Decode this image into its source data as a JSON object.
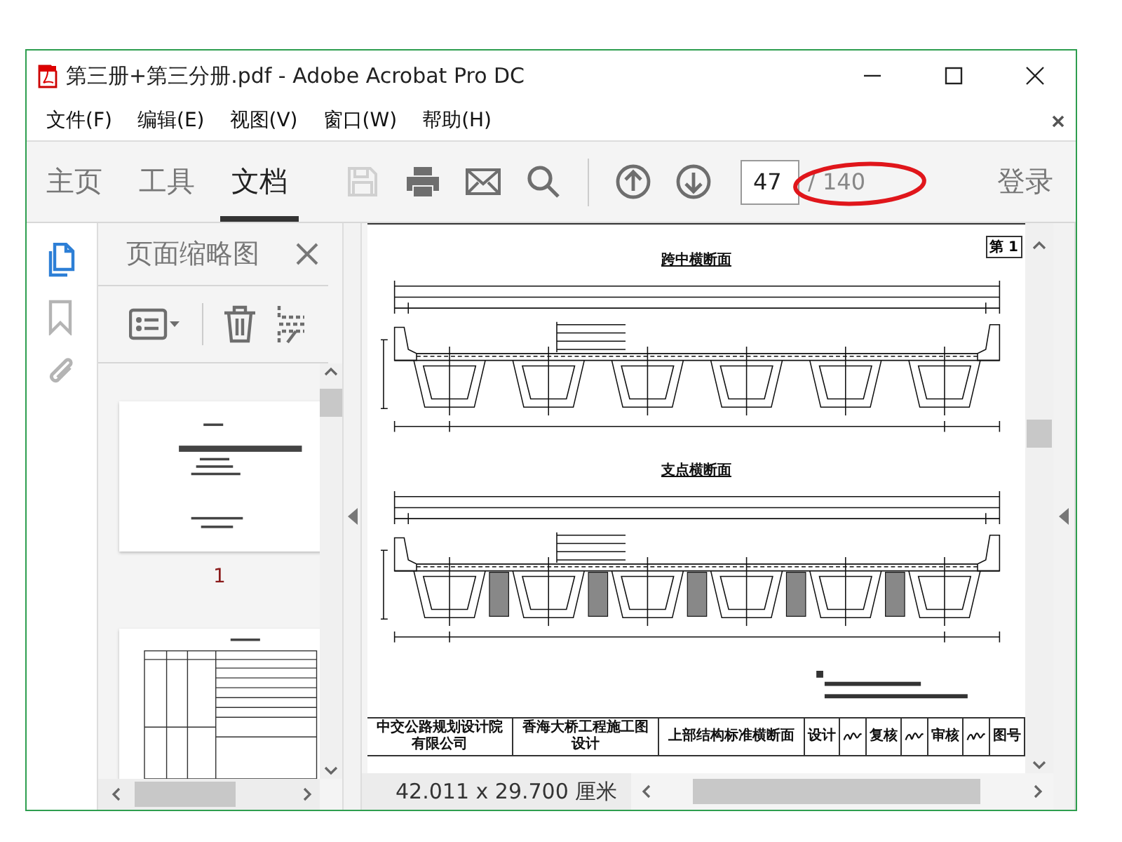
{
  "window": {
    "title": "第三册+第三分册.pdf - Adobe Acrobat Pro DC"
  },
  "menu": [
    "文件(F)",
    "编辑(E)",
    "视图(V)",
    "窗口(W)",
    "帮助(H)"
  ],
  "toolbar": {
    "tabs": [
      {
        "label": "主页",
        "selected": false
      },
      {
        "label": "工具",
        "selected": false
      },
      {
        "label": "文档",
        "selected": true
      }
    ],
    "tools": [
      {
        "kind": "save",
        "disabled": true
      },
      {
        "kind": "print",
        "disabled": false
      },
      {
        "kind": "mail",
        "disabled": false
      },
      {
        "kind": "search",
        "disabled": false
      },
      {
        "kind": "divider"
      },
      {
        "kind": "prev",
        "disabled": false
      },
      {
        "kind": "next",
        "disabled": false
      }
    ],
    "page_field": {
      "value": "47"
    },
    "page_total": "/ 140",
    "sign_in": "登录"
  },
  "sidebar": {
    "rail": [
      {
        "kind": "pages",
        "selected": true
      },
      {
        "kind": "bookmarks",
        "selected": false
      },
      {
        "kind": "attachments",
        "selected": false
      }
    ],
    "panel_title": "页面缩略图",
    "thumbnails": [
      {
        "label": "1"
      }
    ]
  },
  "document": {
    "corner_tag": "第 1",
    "sections": [
      {
        "title": "跨中横断面",
        "kind": "midspan"
      },
      {
        "title": "支点横断面",
        "kind": "support"
      }
    ],
    "title_block": [
      {
        "kind": "text",
        "text": "中交公路规划设计院有限公司"
      },
      {
        "kind": "text",
        "text": "香海大桥工程施工图设计"
      },
      {
        "kind": "text",
        "text": "上部结构标准横断面"
      },
      {
        "kind": "label",
        "text": "设计"
      },
      {
        "kind": "signature"
      },
      {
        "kind": "label",
        "text": "复核"
      },
      {
        "kind": "signature"
      },
      {
        "kind": "label",
        "text": "审核"
      },
      {
        "kind": "signature"
      },
      {
        "kind": "label",
        "text": "图号"
      }
    ],
    "page_size": "42.011 x 29.700 厘米"
  }
}
